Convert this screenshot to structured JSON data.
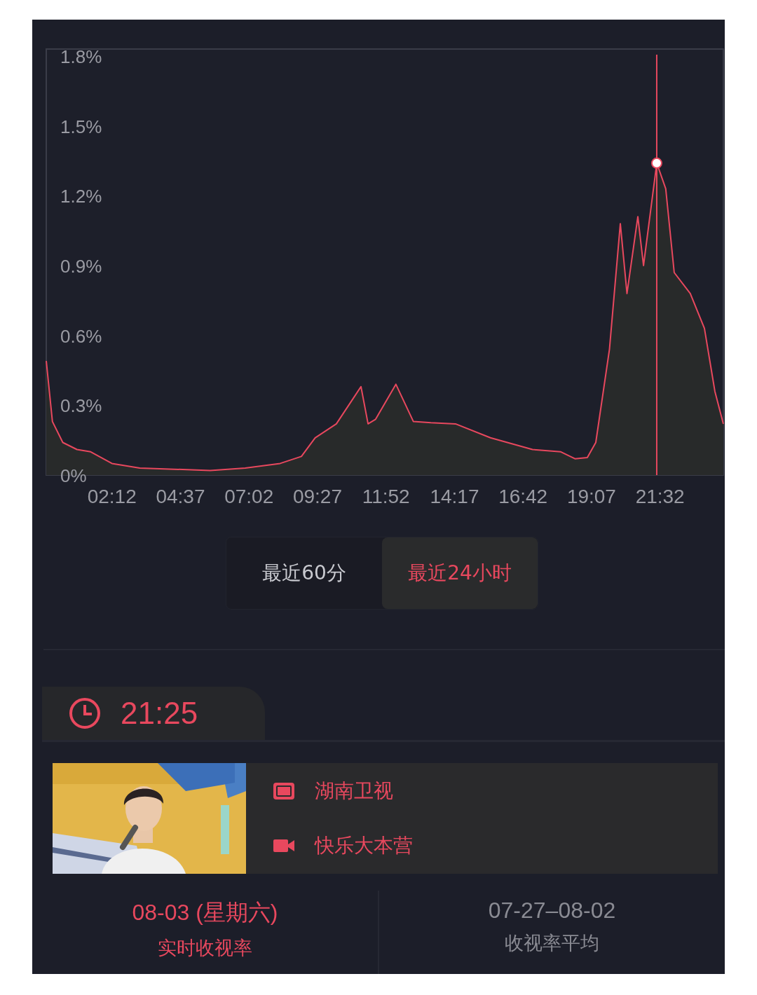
{
  "chart": {
    "chart_data": {
      "type": "area",
      "xlim": [
        -7,
        1426
      ],
      "ylim": [
        0,
        1.8
      ],
      "yticks": [
        {
          "value": 0,
          "label": "0%"
        },
        {
          "value": 0.3,
          "label": "0.3%"
        },
        {
          "value": 0.6,
          "label": "0.6%"
        },
        {
          "value": 0.9,
          "label": "0.9%"
        },
        {
          "value": 1.2,
          "label": "1.2%"
        },
        {
          "value": 1.5,
          "label": "1.5%"
        },
        {
          "value": 1.8,
          "label": "1.8%"
        }
      ],
      "xticks": [
        {
          "value": 132,
          "label": "02:12"
        },
        {
          "value": 277,
          "label": "04:37"
        },
        {
          "value": 422,
          "label": "07:02"
        },
        {
          "value": 567,
          "label": "09:27"
        },
        {
          "value": 712,
          "label": "11:52"
        },
        {
          "value": 857,
          "label": "14:17"
        },
        {
          "value": 1002,
          "label": "16:42"
        },
        {
          "value": 1147,
          "label": "19:07"
        },
        {
          "value": 1292,
          "label": "21:32"
        }
      ],
      "x": [
        -7,
        6,
        28,
        58,
        87,
        132,
        191,
        340,
        414,
        488,
        533,
        562,
        607,
        659,
        674,
        690,
        733,
        770,
        807,
        859,
        933,
        1022,
        1082,
        1112,
        1138,
        1156,
        1185,
        1208,
        1222,
        1245,
        1257,
        1285,
        1304,
        1322,
        1356,
        1386,
        1408,
        1426
      ],
      "series": [
        {
          "color": "#e8485e",
          "values": [
            0.49,
            0.23,
            0.14,
            0.11,
            0.1,
            0.05,
            0.03,
            0.02,
            0.03,
            0.05,
            0.08,
            0.16,
            0.22,
            0.38,
            0.22,
            0.24,
            0.39,
            0.23,
            0.225,
            0.22,
            0.16,
            0.11,
            0.1,
            0.07,
            0.075,
            0.14,
            0.54,
            1.08,
            0.78,
            1.11,
            0.9,
            1.34,
            1.23,
            0.87,
            0.78,
            0.63,
            0.36,
            0.22
          ]
        }
      ],
      "ref_lines": [
        {
          "axis": "x",
          "value": 1285
        }
      ]
    }
  },
  "range_tabs": [
    {
      "label": "最近60分",
      "selected": false
    },
    {
      "label": "最近24小时",
      "selected": true
    }
  ],
  "time_tab": {
    "time": "21:25"
  },
  "program": {
    "channel": "湖南卫视",
    "show": "快乐大本营"
  },
  "stats": [
    {
      "value": "08-03 (星期六)",
      "label": "实时收视率",
      "highlight": true
    },
    {
      "value": "07-27–08-02",
      "label": "收视率平均",
      "highlight": false
    }
  ]
}
